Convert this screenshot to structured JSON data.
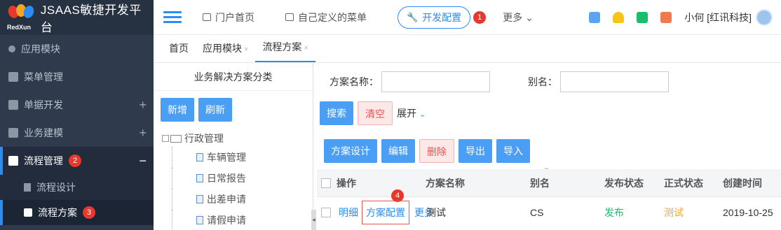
{
  "brand": {
    "logo_text": "RedXun",
    "title": "JSAAS敏捷开发平台"
  },
  "sidebar": {
    "items": [
      {
        "label": "应用模块"
      },
      {
        "label": "菜单管理"
      },
      {
        "label": "单据开发"
      },
      {
        "label": "业务建模"
      },
      {
        "label": "流程管理",
        "badge": "2"
      },
      {
        "label": "流程设计"
      },
      {
        "label": "流程方案",
        "badge": "3"
      }
    ]
  },
  "header": {
    "nav": [
      "门户首页",
      "自己定义的菜单"
    ],
    "active": "开发配置",
    "active_badge": "1",
    "more": "更多",
    "user": "小何 [红讯科技]"
  },
  "tabs": [
    {
      "label": "首页"
    },
    {
      "label": "应用模块"
    },
    {
      "label": "流程方案"
    }
  ],
  "category": {
    "title": "业务解决方案分类",
    "add": "新增",
    "refresh": "刷新",
    "root": "行政管理",
    "children": [
      "车辆管理",
      "日常报告",
      "出差申请",
      "请假申请"
    ]
  },
  "search": {
    "name_label": "方案名称：",
    "alias_label": "别名：",
    "search_btn": "搜索",
    "clear_btn": "清空",
    "expand": "展开"
  },
  "toolbar": {
    "design": "方案设计",
    "edit": "编辑",
    "delete": "删除",
    "export": "导出",
    "import": "导入"
  },
  "table": {
    "headers": [
      "操作",
      "方案名称",
      "别名",
      "发布状态",
      "正式状态",
      "创建时间"
    ],
    "row": {
      "detail": "明细",
      "config": "方案配置",
      "more": "更多",
      "name": "测试",
      "alias": "CS",
      "publish": "发布",
      "formal": "测试",
      "created": "2019-10-25"
    },
    "badge": "4"
  },
  "colors": {
    "accent": "#2d8cf0",
    "danger": "#e8372c",
    "green": "#19be6b",
    "orange": "#f5a623"
  }
}
